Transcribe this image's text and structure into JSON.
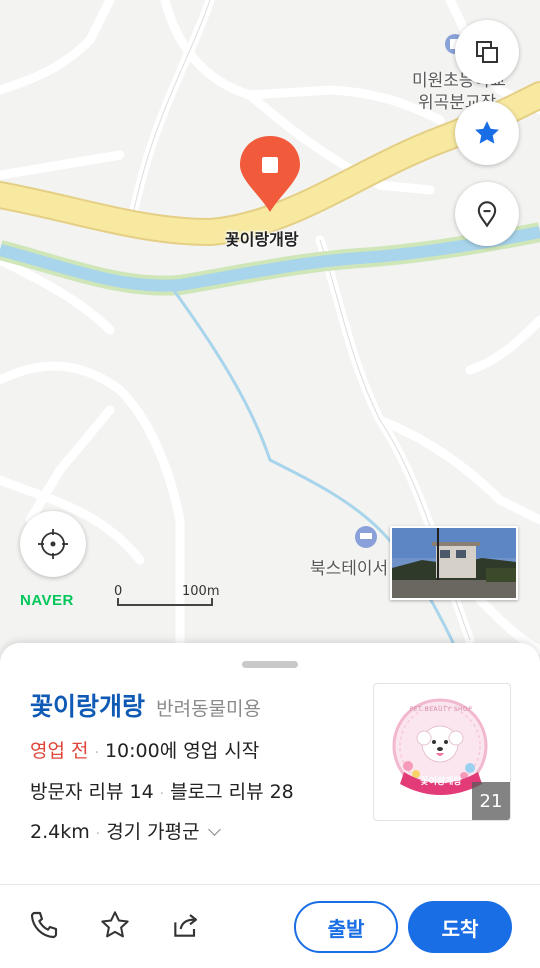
{
  "map": {
    "labels": {
      "school_line1": "미원초등학교",
      "school_line2": "위곡분교장",
      "guesthouse": "북스테이서",
      "pin_name": "꽃이랑개랑"
    },
    "brand": "NAVER",
    "scale": {
      "start": "0",
      "end": "100m"
    },
    "colors": {
      "pin": "#f25a3c",
      "road": "#f7e9a0",
      "river": "#a8d4ec",
      "star": "#1a6ee5"
    }
  },
  "place": {
    "name": "꽃이랑개랑",
    "category": "반려동물미용",
    "status": "영업 전",
    "hours": "10:00에 영업 시작",
    "visitor_reviews": "방문자 리뷰 14",
    "blog_reviews": "블로그 리뷰 28",
    "distance": "2.4km",
    "region": "경기 가평군",
    "photo_count": "21",
    "logo_text": "PET BEAUTY SHOP",
    "logo_name": "꽃이랑개랑"
  },
  "actions": {
    "depart": "출발",
    "arrive": "도착"
  },
  "icons": [
    "layers-icon",
    "star-icon",
    "location-pin-icon",
    "current-location-icon",
    "phone-icon",
    "favorite-star-icon",
    "share-icon",
    "school-icon",
    "bed-icon"
  ]
}
